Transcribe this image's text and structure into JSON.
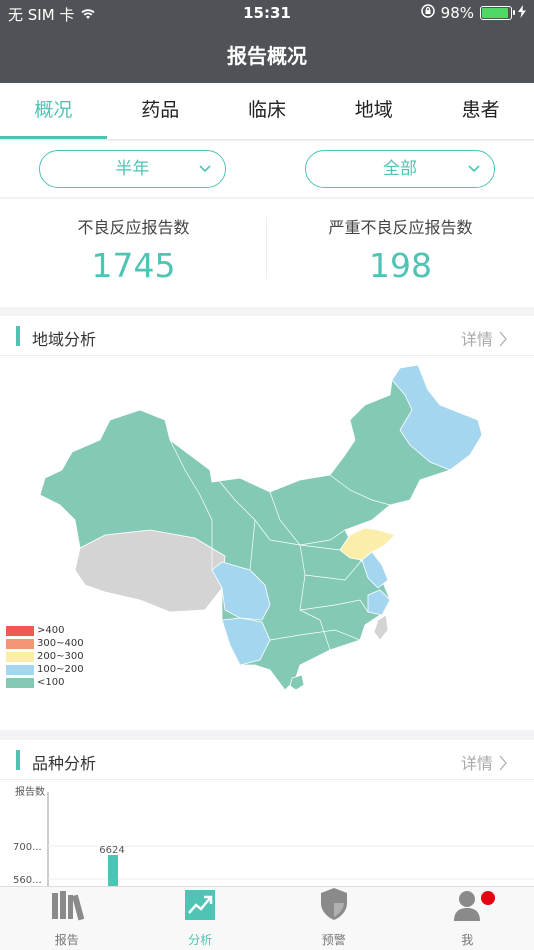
{
  "status": {
    "carrier": "无 SIM 卡",
    "time": "15:31",
    "battery": "98%"
  },
  "header": {
    "title": "报告概况"
  },
  "tabs": [
    "概况",
    "药品",
    "临床",
    "地域",
    "患者"
  ],
  "filters": {
    "period": "半年",
    "scope": "全部"
  },
  "stats": [
    {
      "label": "不良反应报告数",
      "value": "1745"
    },
    {
      "label": "严重不良反应报告数",
      "value": "198"
    }
  ],
  "region": {
    "title": "地域分析",
    "more": "详情",
    "legend": [
      {
        "label": ">400",
        "color": "#ee5a52"
      },
      {
        "label": "300~400",
        "color": "#f39577"
      },
      {
        "label": "200~300",
        "color": "#faeeaa"
      },
      {
        "label": "100~200",
        "color": "#a5d6f0"
      },
      {
        "label": "<100",
        "color": "#84c9b6"
      }
    ]
  },
  "variety": {
    "title": "品种分析",
    "more": "详情",
    "chart_data": {
      "type": "bar",
      "ylabel": "报告数",
      "yticks": [
        "700...",
        "560..."
      ],
      "values": [
        6624
      ],
      "value_labels": [
        "6624"
      ]
    }
  },
  "tabbar": [
    {
      "label": "报告",
      "icon": "books-icon"
    },
    {
      "label": "分析",
      "icon": "trend-chart-icon"
    },
    {
      "label": "预警",
      "icon": "shield-icon"
    },
    {
      "label": "我",
      "icon": "person-icon"
    }
  ]
}
